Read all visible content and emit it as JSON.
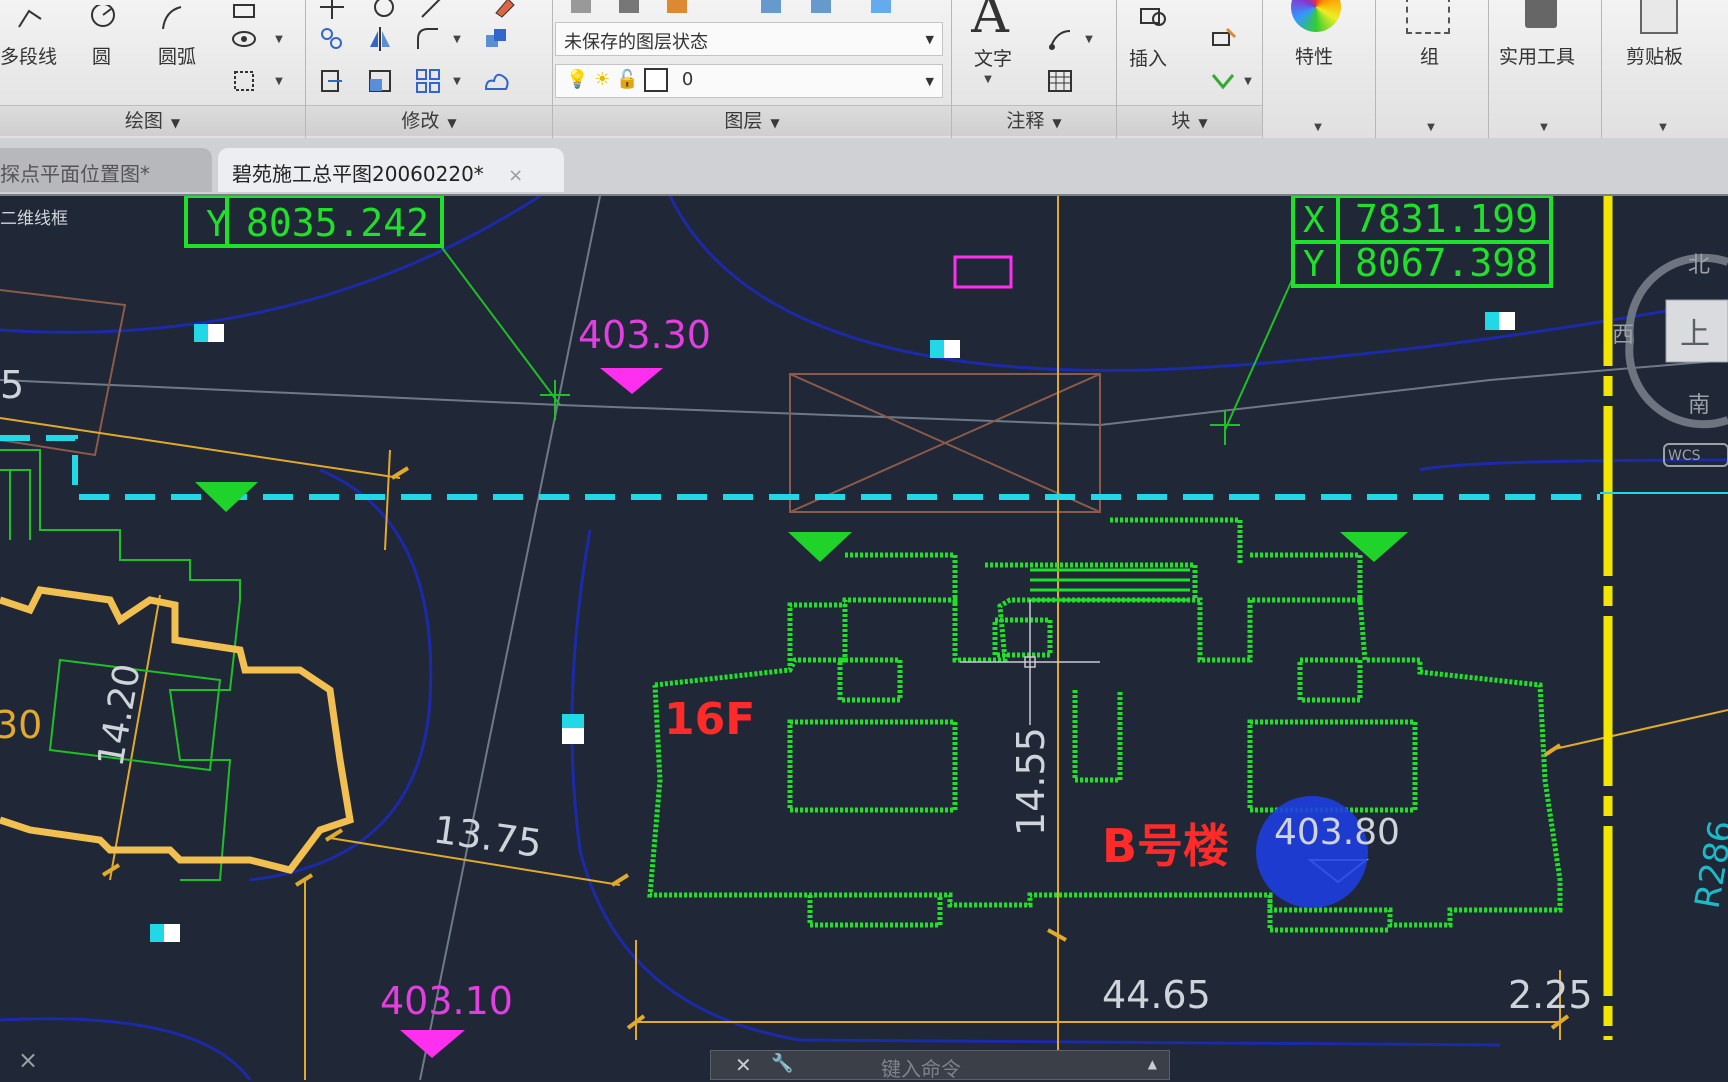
{
  "ribbon": {
    "draw_panel": {
      "title": "绘图",
      "polyline_label": "多段线",
      "circle_label": "圆",
      "arc_label": "圆弧"
    },
    "modify_panel": {
      "title": "修改"
    },
    "layer_panel": {
      "title": "图层",
      "state_combo": "未保存的图层状态",
      "layer_combo": "0"
    },
    "annotation_panel": {
      "title": "注释",
      "text_label": "文字"
    },
    "block_panel": {
      "title": "块",
      "insert_label": "插入"
    },
    "properties_label": "特性",
    "group_label": "组",
    "utilities_label": "实用工具",
    "clipboard_label": "剪贴板"
  },
  "tabs": [
    {
      "label": "探点平面位置图*"
    },
    {
      "label": "碧苑施工总平图20060220*",
      "close": "×"
    }
  ],
  "viewport": {
    "view_label": "二维线框",
    "coords_left": {
      "y_label": "Y",
      "y_value": "8035.242"
    },
    "coords_right": {
      "x_label": "X",
      "x_value": "7831.199",
      "y_label": "Y",
      "y_value": "8067.398"
    },
    "elevations": [
      "403.30",
      "403.10",
      "403.80"
    ],
    "building_label": "B号楼",
    "floors_label": "16F",
    "dims": {
      "d1375": "13.75",
      "d1420": "14.20",
      "d1455": "14.55",
      "d4465": "44.65",
      "d225": "2.25",
      "r286": "R286",
      "partial_5": "5",
      "partial_30": "30"
    },
    "viewcube": {
      "north": "北",
      "south": "南",
      "west": "西",
      "top": "上",
      "wcs": "WCS"
    }
  },
  "command_line": {
    "placeholder": "键入命令"
  },
  "colors": {
    "background": "#202736",
    "building": "#22e02a",
    "accent_cyan": "#22d8e6",
    "magenta": "#ff2ff0",
    "dims_gold": "#e2aa2c",
    "annotation_red": "#ff2a2a"
  }
}
